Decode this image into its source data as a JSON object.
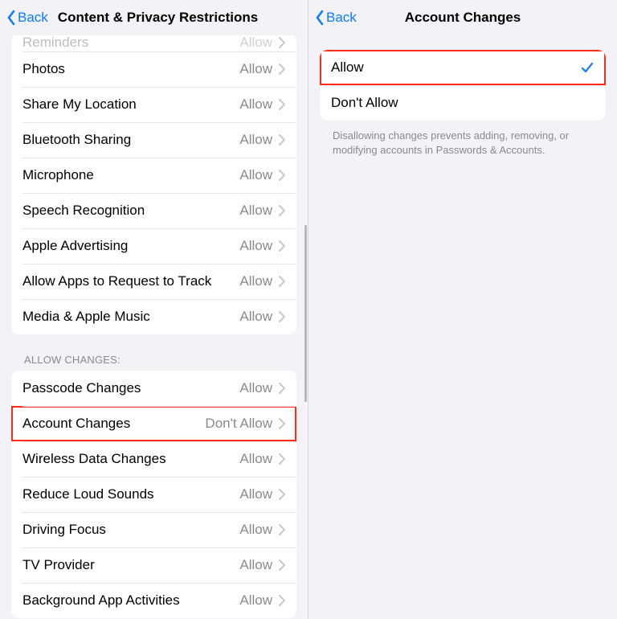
{
  "left": {
    "back_label": "Back",
    "title": "Content & Privacy Restrictions",
    "group1": [
      {
        "label": "Reminders",
        "value": "Allow",
        "cutoff": true
      },
      {
        "label": "Photos",
        "value": "Allow"
      },
      {
        "label": "Share My Location",
        "value": "Allow"
      },
      {
        "label": "Bluetooth Sharing",
        "value": "Allow"
      },
      {
        "label": "Microphone",
        "value": "Allow"
      },
      {
        "label": "Speech Recognition",
        "value": "Allow"
      },
      {
        "label": "Apple Advertising",
        "value": "Allow"
      },
      {
        "label": "Allow Apps to Request to Track",
        "value": "Allow"
      },
      {
        "label": "Media & Apple Music",
        "value": "Allow"
      }
    ],
    "group2_header": "ALLOW CHANGES:",
    "group2": [
      {
        "label": "Passcode Changes",
        "value": "Allow"
      },
      {
        "label": "Account Changes",
        "value": "Don't Allow",
        "highlight": true
      },
      {
        "label": "Wireless Data Changes",
        "value": "Allow"
      },
      {
        "label": "Reduce Loud Sounds",
        "value": "Allow"
      },
      {
        "label": "Driving Focus",
        "value": "Allow"
      },
      {
        "label": "TV Provider",
        "value": "Allow"
      },
      {
        "label": "Background App Activities",
        "value": "Allow"
      }
    ]
  },
  "right": {
    "back_label": "Back",
    "title": "Account Changes",
    "options": [
      {
        "label": "Allow",
        "selected": true,
        "highlight": true
      },
      {
        "label": "Don't Allow",
        "selected": false
      }
    ],
    "footer": "Disallowing changes prevents adding, removing, or modifying accounts in Passwords & Accounts."
  }
}
